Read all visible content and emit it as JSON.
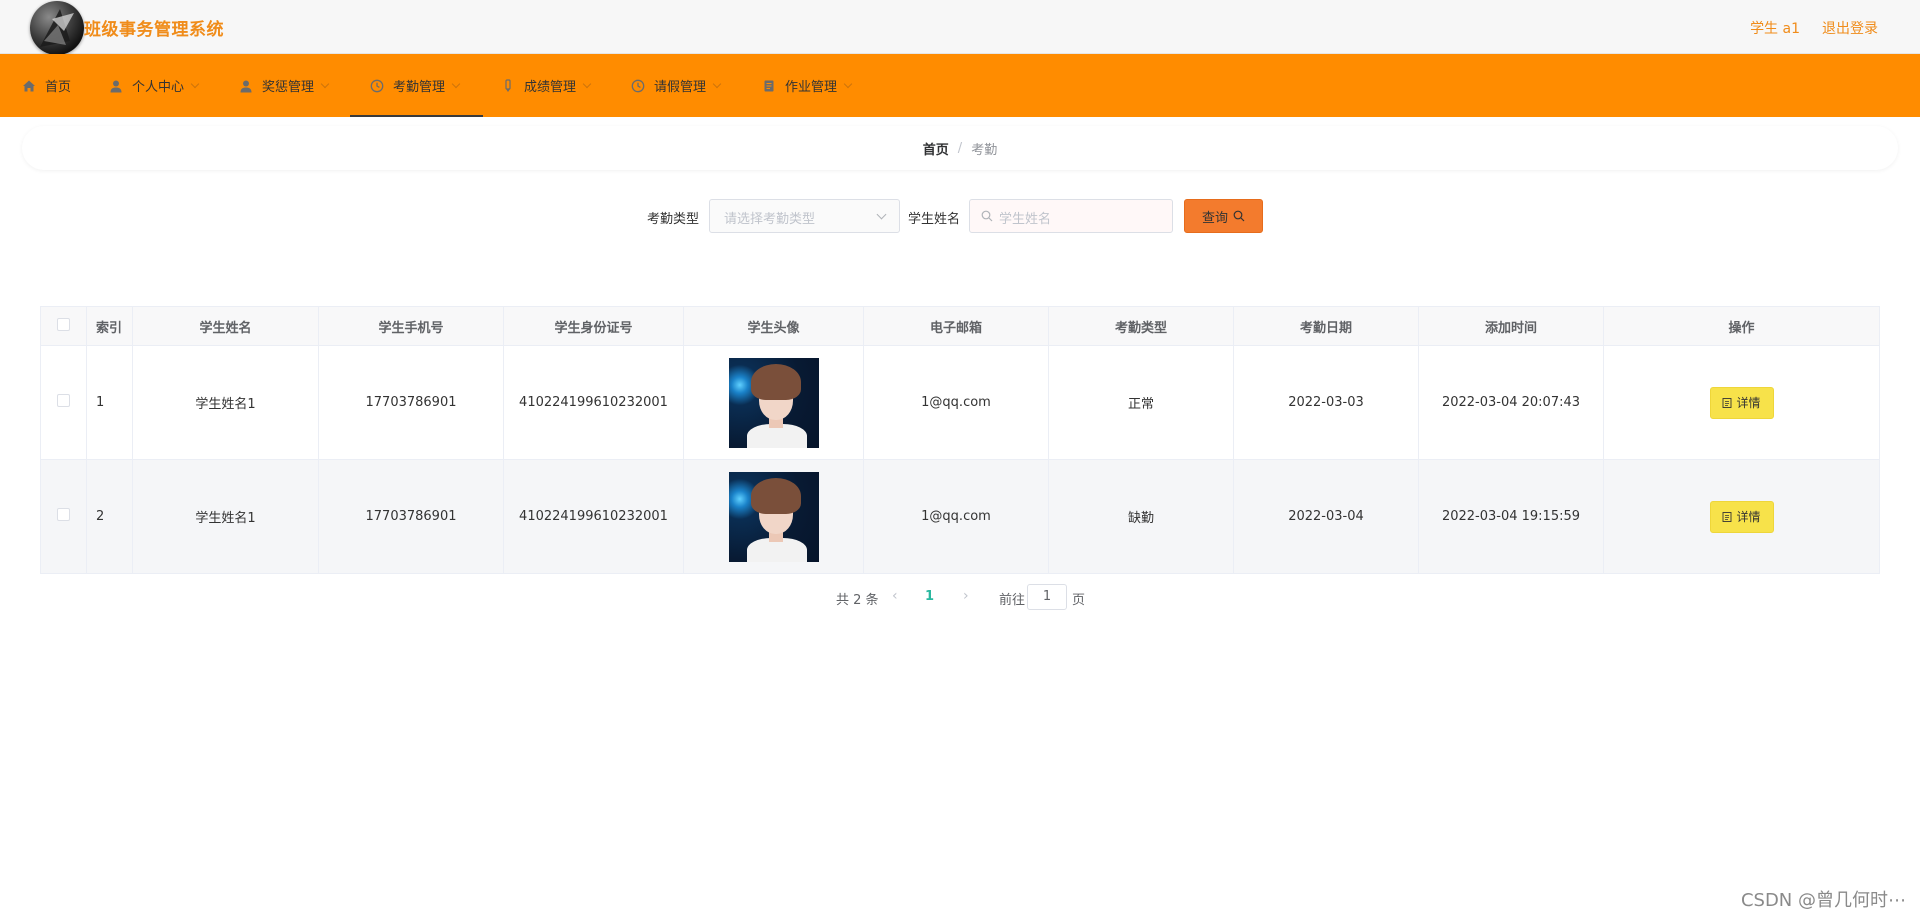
{
  "header": {
    "app_title": "班级事务管理系统",
    "user_label": "学生 a1",
    "logout_label": "退出登录"
  },
  "nav": {
    "items": [
      {
        "label": "首页",
        "icon": "home-icon"
      },
      {
        "label": "个人中心",
        "icon": "user-icon"
      },
      {
        "label": "奖惩管理",
        "icon": "user-icon"
      },
      {
        "label": "考勤管理",
        "icon": "clock-icon"
      },
      {
        "label": "成绩管理",
        "icon": "pen-icon"
      },
      {
        "label": "请假管理",
        "icon": "clock-icon"
      },
      {
        "label": "作业管理",
        "icon": "document-icon"
      }
    ],
    "active_index": 3
  },
  "breadcrumb": {
    "home": "首页",
    "separator": "/",
    "current": "考勤"
  },
  "search": {
    "type_label": "考勤类型",
    "type_placeholder": "请选择考勤类型",
    "name_label": "学生姓名",
    "name_placeholder": "学生姓名",
    "query_label": "查询"
  },
  "table": {
    "headers": [
      "索引",
      "学生姓名",
      "学生手机号",
      "学生身份证号",
      "学生头像",
      "电子邮箱",
      "考勤类型",
      "考勤日期",
      "添加时间",
      "操作"
    ],
    "rows": [
      {
        "index": "1",
        "name": "学生姓名1",
        "phone": "17703786901",
        "id_card": "410224199610232001",
        "email": "1@qq.com",
        "type": "正常",
        "date": "2022-03-03",
        "added": "2022-03-04 20:07:43",
        "action": "详情"
      },
      {
        "index": "2",
        "name": "学生姓名1",
        "phone": "17703786901",
        "id_card": "410224199610232001",
        "email": "1@qq.com",
        "type": "缺勤",
        "date": "2022-03-04",
        "added": "2022-03-04 19:15:59",
        "action": "详情"
      }
    ]
  },
  "pagination": {
    "total": "共 2 条",
    "current_page": "1",
    "goto_prefix": "前往",
    "goto_value": "1",
    "goto_suffix": "页"
  },
  "watermark": "CSDN @曾几何时⋯",
  "colors": {
    "nav_bg": "#ff8c00",
    "accent": "#f08c1a",
    "query_button": "#f37b2d",
    "detail_button": "#f7e24a",
    "page_active": "#2ab8a0"
  }
}
